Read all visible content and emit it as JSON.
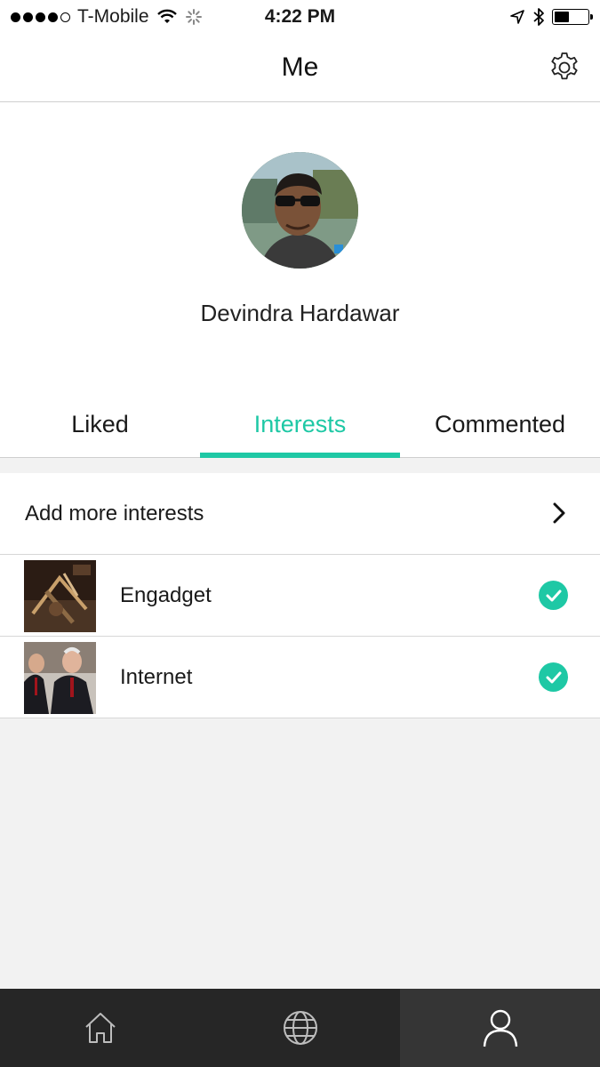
{
  "status_bar": {
    "carrier": "T-Mobile",
    "time": "4:22 PM",
    "signal_bars": 4,
    "battery_level": 0.45
  },
  "header": {
    "title": "Me",
    "settings_icon": "gear-icon"
  },
  "profile": {
    "name": "Devindra Hardawar"
  },
  "tabs": [
    {
      "label": "Liked",
      "active": false
    },
    {
      "label": "Interests",
      "active": true
    },
    {
      "label": "Commented",
      "active": false
    }
  ],
  "interests": {
    "add_label": "Add more interests",
    "items": [
      {
        "label": "Engadget",
        "checked": true
      },
      {
        "label": "Internet",
        "checked": true
      }
    ]
  },
  "tabbar": {
    "items": [
      {
        "icon": "home-icon",
        "active": false
      },
      {
        "icon": "globe-icon",
        "active": false
      },
      {
        "icon": "profile-icon",
        "active": true
      }
    ]
  },
  "colors": {
    "accent": "#1ec8a5",
    "tabbar_bg": "#262626",
    "tabbar_active_bg": "#353535"
  }
}
